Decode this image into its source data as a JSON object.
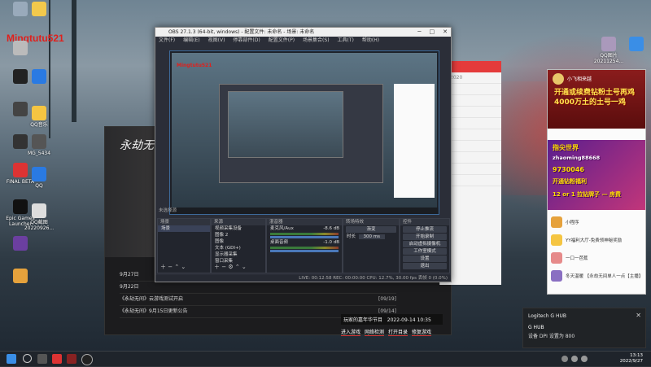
{
  "desktop": {
    "username": "Mingtutu521",
    "icons": [
      {
        "label": "",
        "icon": "recycle-bin-icon"
      },
      {
        "label": "",
        "icon": "folder-icon"
      },
      {
        "label": "",
        "icon": "computer-icon"
      },
      {
        "label": "",
        "icon": "tiktok-icon"
      },
      {
        "label": "",
        "icon": "edge-browser-icon"
      },
      {
        "label": "",
        "icon": "game-icon"
      },
      {
        "label": "",
        "icon": "game-icon"
      },
      {
        "label": "MG_5434",
        "icon": "image-file-icon"
      },
      {
        "label": "FINAL BETA",
        "icon": "game-icon"
      },
      {
        "label": "QQ",
        "icon": "qq-icon"
      },
      {
        "label": "QQ音乐",
        "icon": "qq-music-icon"
      },
      {
        "label": "Epic Games Launcher",
        "icon": "epic-games-icon"
      },
      {
        "label": "QQ截图20220926...",
        "icon": "image-file-icon"
      },
      {
        "label": "",
        "icon": "app-icon"
      },
      {
        "label": "",
        "icon": "app-icon"
      },
      {
        "label": "QQ图片20211254...",
        "icon": "image-file-icon"
      },
      {
        "label": "",
        "icon": "control-panel-icon"
      }
    ]
  },
  "game_window": {
    "logo": "永劫无间",
    "news": [
      {
        "title": "9月27日",
        "date": ""
      },
      {
        "title": "9月22日",
        "date": ""
      },
      {
        "title": "《永劫无间》云游戏测试开启",
        "date": "[09/19]"
      },
      {
        "title": "《永劫无间》9月15日更新公告",
        "date": "[09/14]"
      }
    ],
    "footer_text": "玩家的嘉年华节目",
    "footer_date": "2022-09-14 10:35",
    "footer_links": [
      "进入游戏",
      "网络检测",
      "打开目录",
      "修复游戏"
    ]
  },
  "white_window": {
    "rows": [
      "2020",
      "",
      "",
      "",
      "",
      "",
      "",
      "",
      "",
      ""
    ]
  },
  "obs": {
    "title": "OBS 27.1.3 (64-bit, windows) - 配置文件: 未命名 - 场景: 未命名",
    "menu": [
      "文件(F)",
      "编辑(E)",
      "视图(V)",
      "停靠部件(D)",
      "配置文件(P)",
      "场景集合(S)",
      "工具(T)",
      "帮助(H)"
    ],
    "preview_label": "Mingtutu521",
    "source_bar_label": "未选择源",
    "docks": {
      "scenes": {
        "title": "场景",
        "items": [
          "场景"
        ]
      },
      "sources": {
        "title": "来源",
        "items": [
          "视频采集设备",
          "图像 2",
          "图像",
          "文本 (GDI+)",
          "显示器采集",
          "窗口采集"
        ]
      },
      "mixer": {
        "title": "混音器",
        "items": [
          "麦克风/Aux",
          "桌面音频"
        ],
        "levels": [
          "-8.6 dB",
          "-1.0 dB"
        ]
      },
      "transitions": {
        "title": "转场特效",
        "type": "渐变",
        "duration_label": "时长",
        "duration": "300 ms"
      },
      "controls": {
        "title": "控件",
        "buttons": [
          "停止推流",
          "开始录制",
          "启动虚拟摄像机",
          "工作室模式",
          "设置",
          "退出"
        ]
      }
    },
    "status": "LIVE: 00:12:58   REC: 00:00:00   CPU: 12.7%, 30.00 fps   丢帧 0 (0.0%)"
  },
  "chat": {
    "title": "小飞相来越",
    "notice_lines": [
      "开通或续费钻粉土号再鸡",
      "4000万土的土号一鸡"
    ],
    "ad_lines": [
      "指尖世界",
      "zhaoming88668",
      "9730046",
      "开通钻粉福利",
      "12 or 1 拉钻牌子 — 房费"
    ],
    "messages": [
      {
        "text": "小程序",
        "color": "#e6a23c"
      },
      {
        "text": "YY福利大厅-免费领神秘奖励",
        "color": "#f5c542"
      },
      {
        "text": "一口一芭蕉",
        "color": "#e68a8a"
      },
      {
        "text": "冬天温暖 【永劫无间单人一点【主播】",
        "color": "#8a6fc2"
      }
    ]
  },
  "notification": {
    "app": "Logitech G HUB",
    "title": "G HUB",
    "body": "设备 DPI 设置为 800",
    "close": "✕"
  },
  "taskbar": {
    "time": "13:13",
    "date": "2022/9/27",
    "icons": [
      "windows-start-icon",
      "search-icon",
      "task-view-icon",
      "netease-icon",
      "game-icon",
      "obs-icon"
    ]
  }
}
